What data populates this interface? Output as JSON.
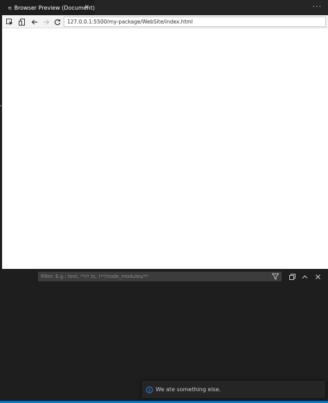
{
  "tab": {
    "label": "Browser Preview (Document)",
    "close_glyph": "✕",
    "icon": "preview-icon"
  },
  "editor_actions": {
    "more_glyph": "···"
  },
  "toolbar": {
    "buttons": [
      "inspect-icon",
      "device-icon",
      "back-arrow-icon",
      "forward-arrow-icon",
      "reload-icon"
    ]
  },
  "url_bar": {
    "value": "127.0.0.1:5500/my-package/WebSite/index.html"
  },
  "panel": {
    "filter_placeholder": "Filter. E.g.: text, **/*.ts, !**/node_modules/**",
    "actions": [
      "filter-icon",
      "restore-panel-icon",
      "chevron-up-icon",
      "close-icon"
    ]
  },
  "notification": {
    "text": "We ate something else.",
    "icon": "info-icon"
  },
  "colors": {
    "editor_bg": "#1e1e1e",
    "accent": "#007acc",
    "info": "#3794ff"
  }
}
